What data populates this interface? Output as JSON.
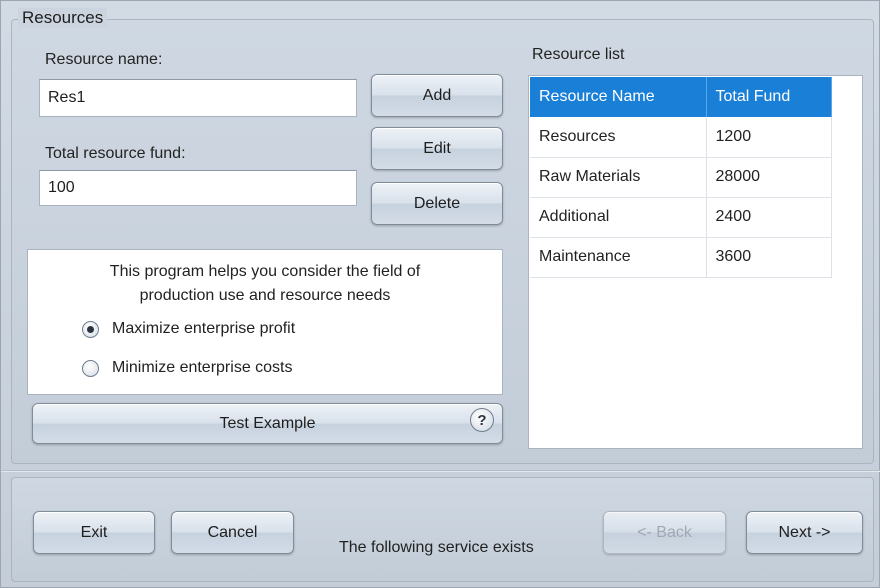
{
  "resources_group": {
    "title": "Resources",
    "resource_name_label": "Resource name:",
    "resource_name_value": "Res1",
    "total_fund_label": "Total resource fund:",
    "total_fund_value": "100",
    "add_label": "Add",
    "edit_label": "Edit",
    "delete_label": "Delete",
    "info_line1": "This program helps you consider the field of",
    "info_line2": "production use and resource needs",
    "options": [
      {
        "label": "Maximize enterprise profit",
        "checked": true
      },
      {
        "label": "Minimize enterprise costs",
        "checked": false
      }
    ],
    "test_example_label": "Test Example",
    "help_glyph": "?",
    "help_icon": "question-mark-icon"
  },
  "resource_list": {
    "title": "Resource list",
    "columns": [
      "Resource Name",
      "Total Fund"
    ],
    "rows": [
      [
        "Resources",
        "1200"
      ],
      [
        "Raw Materials",
        "28000"
      ],
      [
        "Additional",
        "2400"
      ],
      [
        "Maintenance",
        "3600"
      ]
    ],
    "header_color": "#1a7fd6"
  },
  "footer": {
    "exit_label": "Exit",
    "cancel_label": "Cancel",
    "status_text": "The following service exists",
    "back_label": "<- Back",
    "back_enabled": false,
    "next_label": "Next ->"
  }
}
